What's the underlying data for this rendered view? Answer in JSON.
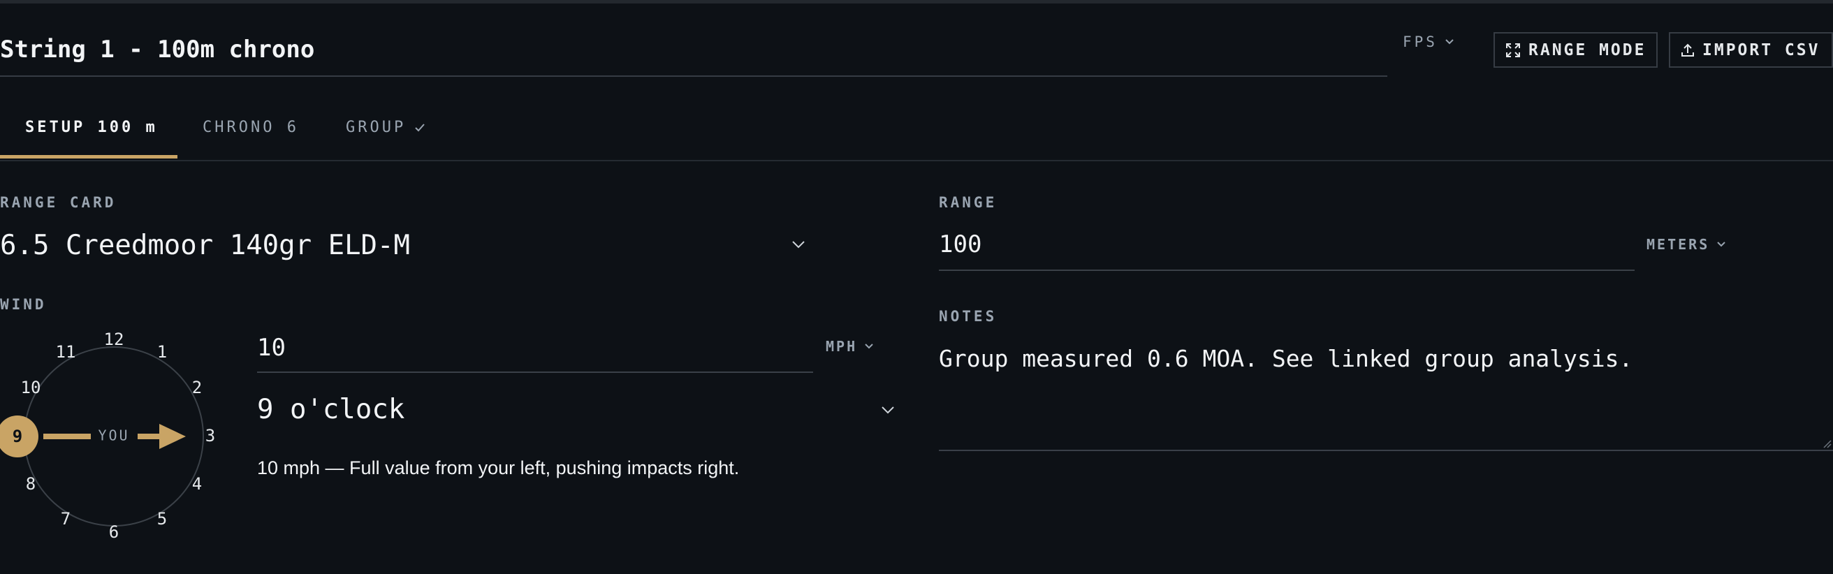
{
  "header": {
    "title": "String 1 - 100m chrono",
    "velocity_unit": "FPS",
    "range_mode_label": "RANGE MODE",
    "import_csv_label": "IMPORT CSV"
  },
  "tabs": [
    {
      "label": "SETUP 100 m",
      "active": true
    },
    {
      "label": "CHRONO 6",
      "active": false
    },
    {
      "label": "GROUP",
      "active": false,
      "check": true
    }
  ],
  "range_card": {
    "label": "RANGE CARD",
    "value": "6.5 Creedmoor 140gr ELD-M"
  },
  "wind": {
    "label": "WIND",
    "speed": "10",
    "speed_unit": "MPH",
    "direction": "9 o'clock",
    "clock_numbers": [
      "12",
      "1",
      "2",
      "3",
      "4",
      "5",
      "6",
      "7",
      "8",
      "9",
      "10",
      "11"
    ],
    "selected_hour": "9",
    "center_label": "YOU",
    "description": "10 mph — Full value from your left, pushing impacts right."
  },
  "range": {
    "label": "RANGE",
    "value": "100",
    "unit": "METERS"
  },
  "notes": {
    "label": "NOTES",
    "value": "Group measured 0.6 MOA. See linked group analysis."
  },
  "colors": {
    "background": "#0d1116",
    "accent": "#c9a465",
    "muted": "#9aa5b1",
    "border": "#363c44"
  }
}
